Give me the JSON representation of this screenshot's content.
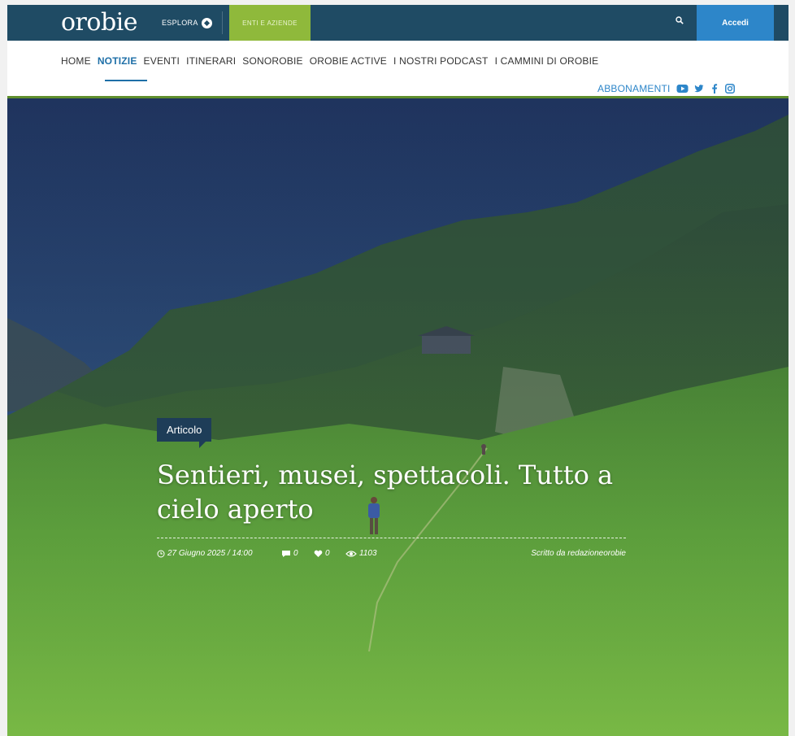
{
  "header": {
    "logo": "orobie",
    "esplora_label": "ESPLORA",
    "enti_label": "ENTI E AZIENDE",
    "login_label": "Accedi"
  },
  "nav": {
    "items": [
      "HOME",
      "NOTIZIE",
      "EVENTI",
      "ITINERARI",
      "SONOROBIE",
      "OROBIE ACTIVE",
      "I NOSTRI PODCAST",
      "I CAMMINI DI OROBIE"
    ],
    "active": "NOTIZIE"
  },
  "subnav": {
    "abbonamenti": "ABBONAMENTI",
    "social_icons": [
      "youtube-icon",
      "twitter-icon",
      "facebook-icon",
      "instagram-icon"
    ]
  },
  "article": {
    "tag": "Articolo",
    "title": "Sentieri, musei, spettacoli. Tutto a cielo aperto",
    "date": "27 Giugno 2025 / 14:00",
    "comments": "0",
    "likes": "0",
    "views": "1103",
    "author": "Scritto da redazioneorobie"
  },
  "colors": {
    "topbar": "#1f4b64",
    "enti": "#8fb93b",
    "accedi": "#2d86c9",
    "active_nav": "#1e6fa7",
    "tag_bg": "#1e3d58"
  }
}
